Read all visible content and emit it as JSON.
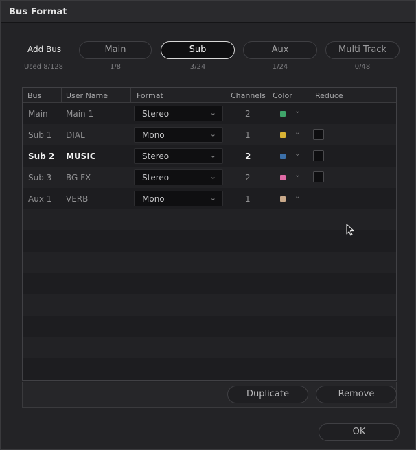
{
  "window": {
    "title": "Bus Format"
  },
  "add_bus": {
    "label": "Add Bus",
    "used": "Used 8/128",
    "buttons": [
      {
        "label": "Main",
        "count": "1/8",
        "active": false
      },
      {
        "label": "Sub",
        "count": "3/24",
        "active": true
      },
      {
        "label": "Aux",
        "count": "1/24",
        "active": false
      },
      {
        "label": "Multi Track",
        "count": "0/48",
        "active": false
      }
    ]
  },
  "table": {
    "columns": [
      "Bus",
      "User Name",
      "Format",
      "Channels",
      "Color",
      "Reduce"
    ],
    "rows": [
      {
        "bus": "Main",
        "user_name": "Main 1",
        "format": "Stereo",
        "channels": "2",
        "color": "#3fa46a",
        "reduce": null,
        "selected": false
      },
      {
        "bus": "Sub 1",
        "user_name": "DIAL",
        "format": "Mono",
        "channels": "1",
        "color": "#d8b234",
        "reduce": false,
        "selected": false
      },
      {
        "bus": "Sub 2",
        "user_name": "MUSIC",
        "format": "Stereo",
        "channels": "2",
        "color": "#3b6fa8",
        "reduce": false,
        "selected": true
      },
      {
        "bus": "Sub 3",
        "user_name": "BG FX",
        "format": "Stereo",
        "channels": "2",
        "color": "#e06aa5",
        "reduce": false,
        "selected": false
      },
      {
        "bus": "Aux 1",
        "user_name": "VERB",
        "format": "Mono",
        "channels": "1",
        "color": "#c9a98a",
        "reduce": null,
        "selected": false
      }
    ]
  },
  "actions": {
    "duplicate": "Duplicate",
    "remove": "Remove",
    "ok": "OK"
  },
  "icons": {
    "dropdown": "chevron-down-icon",
    "cursor": "mouse-pointer-icon"
  }
}
